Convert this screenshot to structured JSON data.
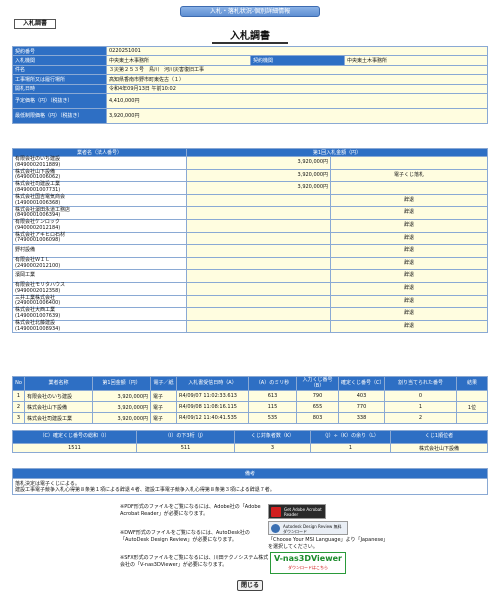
{
  "window_title": "入札・落札状況-個別詳細情報",
  "tag_label": "入札調書",
  "page_title": "入札調書",
  "info": {
    "contract_no_label": "契約番号",
    "contract_no": "0220251001",
    "agency_label": "入札機関",
    "agency": "中央東土木事務所",
    "contract_agency_label": "契約機関",
    "contract_agency": "中央東土木事務所",
    "item_label": "件名",
    "item": "３災第２５３号　鳥川　河川災害復旧工事",
    "location_label": "工事場所又は履行場所",
    "location": "高知県香南市野市町東佐古（１）",
    "open_label": "開札日時",
    "open": "令和4年09月13日 午前10:02",
    "planned_label": "予定価格（円）（税抜き）",
    "planned": "4,410,000円",
    "min_label": "最低制限価格（円）（税抜き）",
    "min": "3,920,000円"
  },
  "bidders": {
    "col_name": "業者名（法人番号）",
    "col_amount": "第1回入札金額（円）",
    "rows": [
      {
        "name": "有限会社のいち建設",
        "id": "(8490002011889)",
        "amount": "3,920,000円",
        "note": ""
      },
      {
        "name": "株式会社山下設備",
        "id": "(6490001006062)",
        "amount": "3,920,000円",
        "note": "電子くじ落札"
      },
      {
        "name": "株式会社司建設工業",
        "id": "(8490001007731)",
        "amount": "3,920,000円",
        "note": ""
      },
      {
        "name": "株式会社国吉電気商会",
        "id": "(1490001006368)",
        "amount": "",
        "note": "辞退"
      },
      {
        "name": "株式会社濵田永道工務店",
        "id": "(8490001006394)",
        "amount": "",
        "note": "辞退"
      },
      {
        "name": "有限会社ケンロック",
        "id": "(9400002012184)",
        "amount": "",
        "note": "辞退"
      },
      {
        "name": "株式会社アキヒロ石材",
        "id": "(7490001006098)",
        "amount": "",
        "note": "辞退"
      },
      {
        "name": "野村設備",
        "id": "",
        "amount": "",
        "note": "辞退"
      },
      {
        "name": "有限会社ＷＩＬ",
        "id": "(2490002012100)",
        "amount": "",
        "note": "辞退"
      },
      {
        "name": "濱岡工業",
        "id": "",
        "amount": "",
        "note": "辞退"
      },
      {
        "name": "有限会社モリタハウス",
        "id": "(9490002012358)",
        "amount": "",
        "note": "辞退"
      },
      {
        "name": "三井工業株式会社",
        "id": "(2490001006400)",
        "amount": "",
        "note": "辞退"
      },
      {
        "name": "株式会社大西工業",
        "id": "(1490001007639)",
        "amount": "",
        "note": "辞退"
      },
      {
        "name": "株式会社北藤建設",
        "id": "(1490001008934)",
        "amount": "",
        "note": "辞退"
      }
    ]
  },
  "lottery": {
    "headers": [
      "No",
      "業者名称",
      "第1回金額（円）",
      "電子／紙",
      "入札書受信日時（A）",
      "（A）のミリ秒",
      "入力くじ番号（B）",
      "確定くじ番号（C）",
      "割り当てられた番号",
      "結果"
    ],
    "rows": [
      [
        "1",
        "有限会社のいち建設",
        "3,920,000円",
        "電子",
        "R4/09/07 11:02:33.613",
        "613",
        "790",
        "403",
        "0",
        ""
      ],
      [
        "2",
        "株式会社山下設備",
        "3,920,000円",
        "電子",
        "R4/09/08 11:08:16.115",
        "115",
        "655",
        "770",
        "1",
        "1位"
      ],
      [
        "3",
        "株式会社司建設工業",
        "3,920,000円",
        "電子",
        "R4/09/12 11:40:41.535",
        "535",
        "803",
        "338",
        "2",
        ""
      ]
    ]
  },
  "summary": {
    "headers": [
      "（C）確定くじ番号の総和（I）",
      "（I）の下3桁（J）",
      "くじ対象者数（K）",
      "（J）÷（K）の余り（L）",
      "くじ1順位者"
    ],
    "values": [
      "1511",
      "511",
      "3",
      "1",
      "株式会社山下設備"
    ]
  },
  "remarks": {
    "header": "備考",
    "line1": "落札決定は電子くじによる。",
    "line2": "建設工事電子競争入札心得第８条第１項による辞退４者、建設工事電子競争入札心得第８条第３項による辞退７者。"
  },
  "plugins": {
    "pdf_text": "※PDF形式のファイルをご覧になるには、Adobe社の「Adobe Acrobat Reader」が必要になります。",
    "dwf_text": "※DWF形式のファイルをご覧になるには、AutoDesk社の「AutoDesk Design Review」が必要になります。",
    "dwf_note": "「Choose Your MSI Language」より「Japanese」を選択してください。",
    "sfx_text": "※SFX形式のファイルをご覧になるには、川田テクノシステム株式会社の「V-nas3DViewer」が必要になります。",
    "adobe_label": "Get Adobe Acrobat Reader",
    "adr_label": "Autodesk Design Review 無料ダウンロード",
    "vnas_label": "V-nas3DViewer",
    "vnas_sub": "ダウンロードはこちら"
  },
  "close_label": "閉じる"
}
